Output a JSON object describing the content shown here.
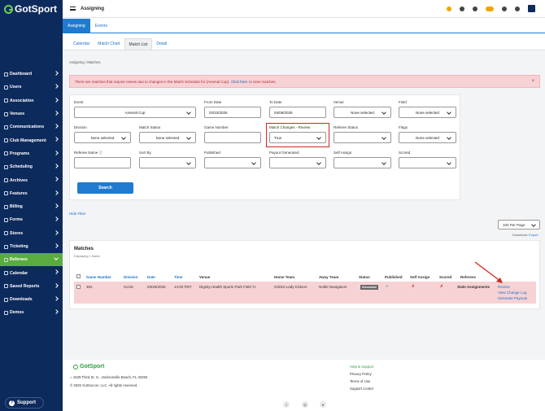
{
  "brand": {
    "logo_text": "GotSport"
  },
  "sidebar": {
    "items": [
      {
        "label": "Dashboard"
      },
      {
        "label": "Users"
      },
      {
        "label": "Association"
      },
      {
        "label": "Venues"
      },
      {
        "label": "Communications"
      },
      {
        "label": "Club Management"
      },
      {
        "label": "Programs"
      },
      {
        "label": "Scheduling"
      },
      {
        "label": "Archives"
      },
      {
        "label": "Features"
      },
      {
        "label": "Billing"
      },
      {
        "label": "Forms"
      },
      {
        "label": "Stores"
      },
      {
        "label": "Ticketing"
      },
      {
        "label": "Referees",
        "active": true
      },
      {
        "label": "Calendar"
      },
      {
        "label": "Saved Reports"
      },
      {
        "label": "Downloads"
      },
      {
        "label": "Demos"
      }
    ],
    "support_label": "Support",
    "support_icon": "?"
  },
  "topbar": {
    "title": "Assigning"
  },
  "main_tabs": [
    "Assigning",
    "Events"
  ],
  "sub_tabs": [
    "Calendar",
    "Match Chart",
    "Match List",
    "Detail"
  ],
  "breadcrumb": {
    "first": "Assigning",
    "sep": "/",
    "second": "Matches"
  },
  "alert": {
    "text": "There are matches that require review due to changes in the Match Schedule for [Arsenal Cup].",
    "link": "Click here",
    "suffix": "to view matches.",
    "close": "×"
  },
  "filters": {
    "event": {
      "label": "Event",
      "value": "Arsenal Cup"
    },
    "from_date": {
      "label": "From Date",
      "value": "02/23/2025"
    },
    "to_date": {
      "label": "To Date",
      "value": "04/06/2025"
    },
    "venue": {
      "label": "Venue",
      "value": "None selected"
    },
    "field": {
      "label": "Field",
      "value": "None selected"
    },
    "division": {
      "label": "Division",
      "value": "None selected"
    },
    "match_status": {
      "label": "Match Status",
      "value": "None selected"
    },
    "game_number": {
      "label": "Game Number",
      "value": ""
    },
    "match_changes": {
      "label": "Match Changes - Review",
      "value": "True"
    },
    "referee_status": {
      "label": "Referee Status",
      "value": ""
    },
    "flags": {
      "label": "Flags",
      "value": "None selected"
    },
    "referee_name": {
      "label": "Referee Name",
      "value": ""
    },
    "sort_by": {
      "label": "Sort By",
      "value": ""
    },
    "published": {
      "label": "Published",
      "value": ""
    },
    "payout_generated": {
      "label": "Payout Generated",
      "value": ""
    },
    "self_assign": {
      "label": "Self Assign",
      "value": ""
    },
    "scored": {
      "label": "Scored",
      "value": ""
    },
    "search_button": "Search"
  },
  "hide_filter": "Hide Filter",
  "per_page": "100 Per Page",
  "download": {
    "label": "Download:",
    "link": "Export"
  },
  "matches": {
    "title": "Matches",
    "displaying": "Displaying 1 Match",
    "columns": [
      "Game Number",
      "Division",
      "Date",
      "Time",
      "Venue",
      "Home Team",
      "Away Team",
      "Status",
      "Published",
      "Self Assign",
      "Scored",
      "Referees"
    ],
    "row": {
      "game_number": "302",
      "division": "GU15",
      "date": "03/29/2025",
      "time": "14:00 PDT",
      "venue": "Dignity Health Sports Park Field 7c",
      "home_team": "G2010 Lady Kickers",
      "away_team": "Noble Navigators",
      "status": "Scheduled",
      "published": "✓",
      "self_assign": "✗",
      "scored": "✗",
      "referees": "Stale Assignments",
      "actions": [
        "Review",
        "View Change Log",
        "Generate Payouts"
      ]
    }
  },
  "footer": {
    "logo": "GotSport",
    "address": "1529 Third St. S., Jacksonville Beach, FL 32250",
    "copyright": "© 2025 GotSoccer, LLC. All rights reserved.",
    "links": [
      "Help & Support",
      "Privacy Policy",
      "Terms of Use",
      "Support Center"
    ],
    "social": [
      "f",
      "◎",
      "▾"
    ]
  },
  "colors": {
    "sidebar": "#0d2a5c",
    "accent": "#1f7bd0",
    "active": "#5aac3f",
    "alert_bg": "#f6d2d5",
    "highlight": "#d0281e"
  }
}
